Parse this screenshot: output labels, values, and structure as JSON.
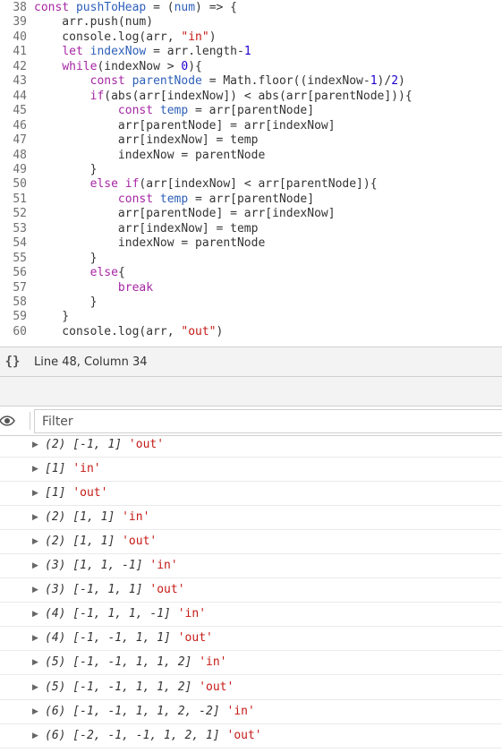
{
  "editor": {
    "lines": [
      {
        "num": "38",
        "tokens": [
          {
            "t": "const ",
            "c": "k"
          },
          {
            "t": "pushToHeap",
            "c": "d"
          },
          {
            "t": " = (",
            "c": "p"
          },
          {
            "t": "num",
            "c": "d"
          },
          {
            "t": ") => {",
            "c": "p"
          }
        ]
      },
      {
        "num": "39",
        "tokens": [
          {
            "t": "    arr.push(num)",
            "c": "p"
          }
        ]
      },
      {
        "num": "40",
        "tokens": [
          {
            "t": "    console.log(arr, ",
            "c": "p"
          },
          {
            "t": "\"in\"",
            "c": "s"
          },
          {
            "t": ")",
            "c": "p"
          }
        ]
      },
      {
        "num": "41",
        "tokens": [
          {
            "t": "    ",
            "c": "p"
          },
          {
            "t": "let ",
            "c": "k"
          },
          {
            "t": "indexNow",
            "c": "d"
          },
          {
            "t": " = arr.length-",
            "c": "p"
          },
          {
            "t": "1",
            "c": "n"
          }
        ]
      },
      {
        "num": "42",
        "tokens": [
          {
            "t": "    ",
            "c": "p"
          },
          {
            "t": "while",
            "c": "k"
          },
          {
            "t": "(indexNow > ",
            "c": "p"
          },
          {
            "t": "0",
            "c": "n"
          },
          {
            "t": "){",
            "c": "p"
          }
        ]
      },
      {
        "num": "43",
        "tokens": [
          {
            "t": "        ",
            "c": "p"
          },
          {
            "t": "const ",
            "c": "k"
          },
          {
            "t": "parentNode",
            "c": "d"
          },
          {
            "t": " = Math.floor((indexNow-",
            "c": "p"
          },
          {
            "t": "1",
            "c": "n"
          },
          {
            "t": ")/",
            "c": "p"
          },
          {
            "t": "2",
            "c": "n"
          },
          {
            "t": ")",
            "c": "p"
          }
        ]
      },
      {
        "num": "44",
        "tokens": [
          {
            "t": "        ",
            "c": "p"
          },
          {
            "t": "if",
            "c": "k"
          },
          {
            "t": "(abs(arr[indexNow]) < abs(arr[parentNode])){",
            "c": "p"
          }
        ]
      },
      {
        "num": "45",
        "tokens": [
          {
            "t": "            ",
            "c": "p"
          },
          {
            "t": "const ",
            "c": "k"
          },
          {
            "t": "temp",
            "c": "d"
          },
          {
            "t": " = arr[parentNode]",
            "c": "p"
          }
        ]
      },
      {
        "num": "46",
        "tokens": [
          {
            "t": "            arr[parentNode] = arr[indexNow]",
            "c": "p"
          }
        ]
      },
      {
        "num": "47",
        "tokens": [
          {
            "t": "            arr[indexNow] = temp",
            "c": "p"
          }
        ]
      },
      {
        "num": "48",
        "tokens": [
          {
            "t": "            indexNow = parentNode",
            "c": "p"
          }
        ]
      },
      {
        "num": "49",
        "tokens": [
          {
            "t": "        }",
            "c": "p"
          }
        ]
      },
      {
        "num": "50",
        "tokens": [
          {
            "t": "        ",
            "c": "p"
          },
          {
            "t": "else if",
            "c": "k"
          },
          {
            "t": "(arr[indexNow] < arr[parentNode]){",
            "c": "p"
          }
        ]
      },
      {
        "num": "51",
        "tokens": [
          {
            "t": "            ",
            "c": "p"
          },
          {
            "t": "const ",
            "c": "k"
          },
          {
            "t": "temp",
            "c": "d"
          },
          {
            "t": " = arr[parentNode]",
            "c": "p"
          }
        ]
      },
      {
        "num": "52",
        "tokens": [
          {
            "t": "            arr[parentNode] = arr[indexNow]",
            "c": "p"
          }
        ]
      },
      {
        "num": "53",
        "tokens": [
          {
            "t": "            arr[indexNow] = temp",
            "c": "p"
          }
        ]
      },
      {
        "num": "54",
        "tokens": [
          {
            "t": "            indexNow = parentNode",
            "c": "p"
          }
        ]
      },
      {
        "num": "55",
        "tokens": [
          {
            "t": "        }",
            "c": "p"
          }
        ]
      },
      {
        "num": "56",
        "tokens": [
          {
            "t": "        ",
            "c": "p"
          },
          {
            "t": "else",
            "c": "k"
          },
          {
            "t": "{",
            "c": "p"
          }
        ]
      },
      {
        "num": "57",
        "tokens": [
          {
            "t": "            ",
            "c": "p"
          },
          {
            "t": "break",
            "c": "k"
          }
        ]
      },
      {
        "num": "58",
        "tokens": [
          {
            "t": "        }",
            "c": "p"
          }
        ]
      },
      {
        "num": "59",
        "tokens": [
          {
            "t": "    }",
            "c": "p"
          }
        ]
      },
      {
        "num": "60",
        "tokens": [
          {
            "t": "    console.log(arr, ",
            "c": "p"
          },
          {
            "t": "\"out\"",
            "c": "s"
          },
          {
            "t": ")",
            "c": "p"
          }
        ]
      }
    ]
  },
  "statusbar": {
    "format_icon": "{}",
    "cursor_position": "Line 48, Column 34"
  },
  "console": {
    "filter_placeholder": "Filter",
    "messages": [
      {
        "array": "(2) [-1, 1]",
        "label": "'out'"
      },
      {
        "array": "[1]",
        "label": "'in'"
      },
      {
        "array": "[1]",
        "label": "'out'"
      },
      {
        "array": "(2) [1, 1]",
        "label": "'in'"
      },
      {
        "array": "(2) [1, 1]",
        "label": "'out'"
      },
      {
        "array": "(3) [1, 1, -1]",
        "label": "'in'"
      },
      {
        "array": "(3) [-1, 1, 1]",
        "label": "'out'"
      },
      {
        "array": "(4) [-1, 1, 1, -1]",
        "label": "'in'"
      },
      {
        "array": "(4) [-1, -1, 1, 1]",
        "label": "'out'"
      },
      {
        "array": "(5) [-1, -1, 1, 1, 2]",
        "label": "'in'"
      },
      {
        "array": "(5) [-1, -1, 1, 1, 2]",
        "label": "'out'"
      },
      {
        "array": "(6) [-1, -1, 1, 1, 2, -2]",
        "label": "'in'"
      },
      {
        "array": "(6) [-2, -1, -1, 1, 2, 1]",
        "label": "'out'"
      }
    ]
  }
}
